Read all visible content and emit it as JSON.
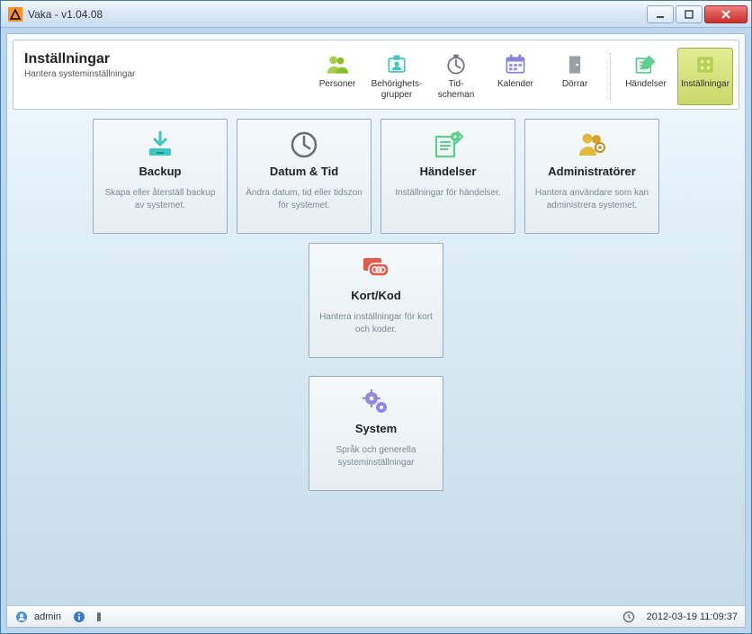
{
  "titlebar": {
    "title": "Vaka - v1.04.08"
  },
  "ribbon": {
    "title": "Inställningar",
    "subtitle": "Hantera systeminställningar",
    "nav": {
      "personer": "Personer",
      "behorighets": "Behörighets-\ngrupper",
      "tidscheman": "Tid-\nscheman",
      "kalender": "Kalender",
      "dorrar": "Dörrar",
      "handelser": "Händelser",
      "installningar": "Inställningar"
    }
  },
  "tiles": {
    "backup": {
      "title": "Backup",
      "desc": "Skapa eller återställ backup av systemet."
    },
    "datumtid": {
      "title": "Datum & Tid",
      "desc": "Ändra datum, tid eller tidszon för systemet."
    },
    "handelser": {
      "title": "Händelser",
      "desc": "Inställningar för händelser."
    },
    "admin": {
      "title": "Administratörer",
      "desc": "Hantera användare som kan administrera systemet."
    },
    "kortkod": {
      "title": "Kort/Kod",
      "desc": "Hantera inställningar för kort och koder."
    },
    "system": {
      "title": "System",
      "desc": "Språk och generella systeminställningar"
    }
  },
  "status": {
    "user": "admin",
    "datetime": "2012-03-19 11:09:37"
  }
}
